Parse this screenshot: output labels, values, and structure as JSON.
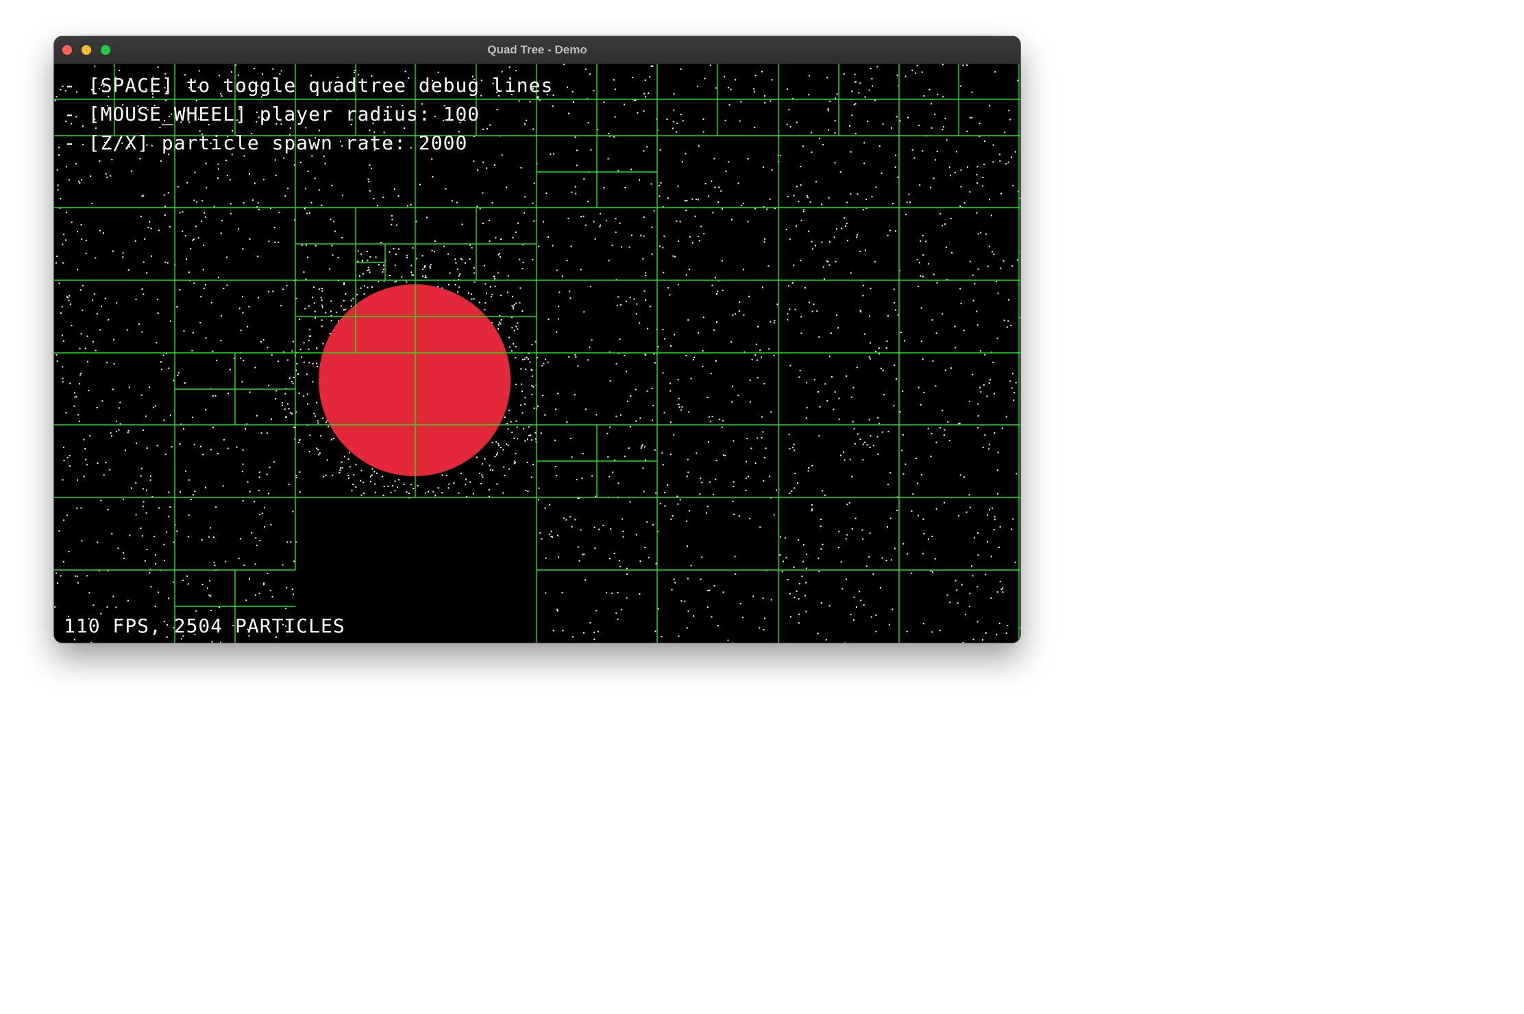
{
  "window": {
    "title": "Quad Tree - Demo",
    "buttons": [
      {
        "name": "close-button",
        "color": "#fe5f57"
      },
      {
        "name": "minimize-button",
        "color": "#febc2e"
      },
      {
        "name": "zoom-button",
        "color": "#28c840"
      }
    ]
  },
  "overlay": {
    "instructions": [
      "- [SPACE] to toggle quadtree debug lines",
      "- [MOUSE_WHEEL] player radius: 100",
      "- [Z/X] particle spawn rate: 2000"
    ],
    "status": "110 FPS, 2504 PARTICLES"
  },
  "scene": {
    "background_color": "#000000",
    "grid_line_color": "#19e619",
    "particle_color": "#ffffff",
    "player_color": "#e32939",
    "player_radius": 100,
    "particle_spawn_rate": 2000,
    "particle_count": 2504,
    "fps": 110,
    "debug_lines": true
  }
}
